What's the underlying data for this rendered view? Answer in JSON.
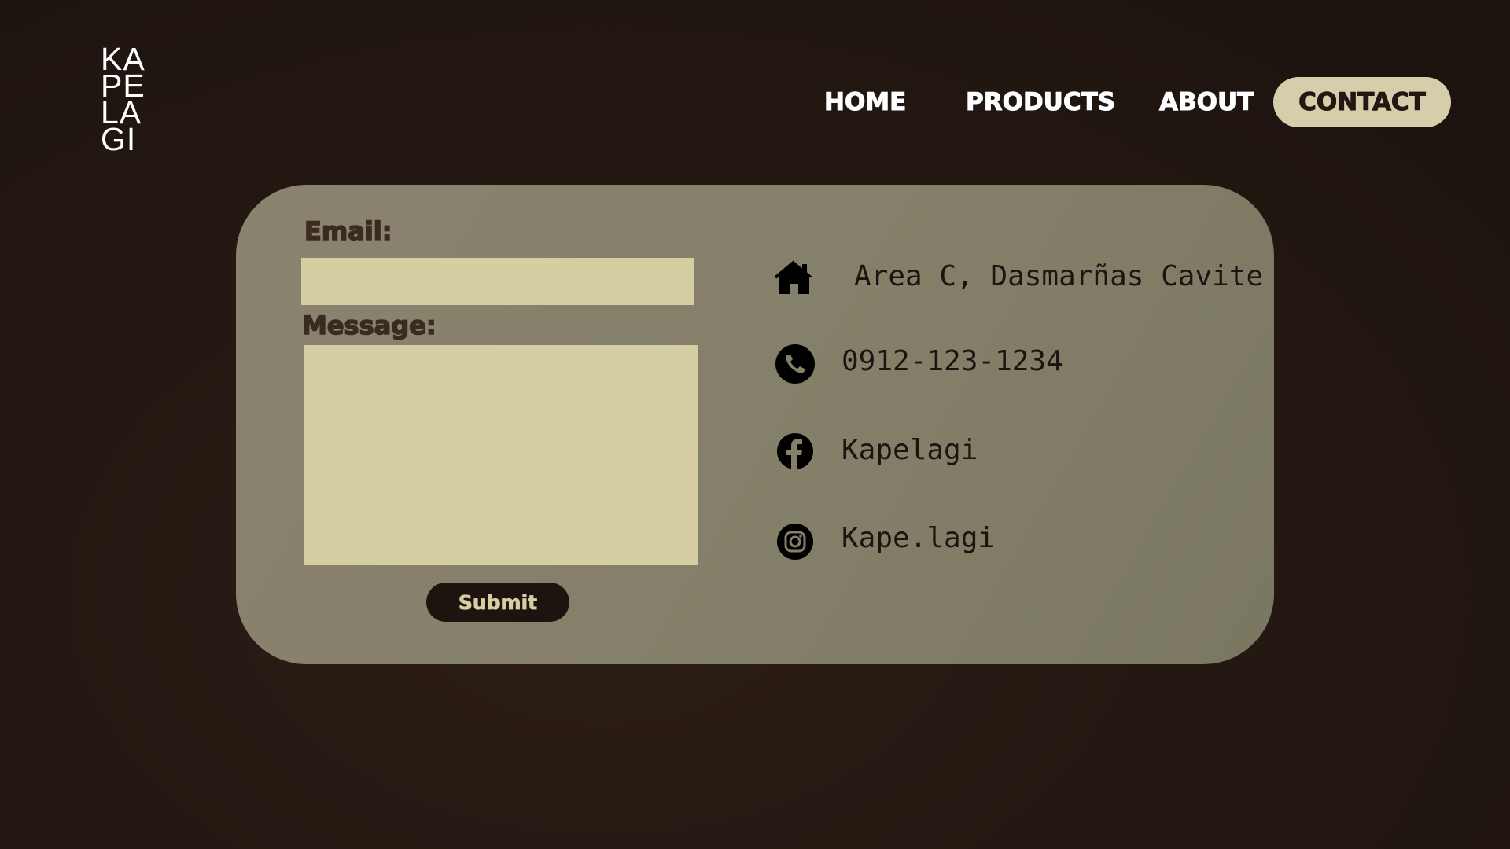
{
  "brand": {
    "logo_rows": [
      "KA",
      "PE",
      "LA",
      "GI"
    ]
  },
  "nav": {
    "items": [
      {
        "label": "HOME"
      },
      {
        "label": "PRODUCTS"
      },
      {
        "label": "ABOUT"
      },
      {
        "label": "CONTACT",
        "active": true
      }
    ],
    "active_color": "#d5ceab"
  },
  "form": {
    "email_label": "Email:",
    "email_value": "",
    "message_label": "Message:",
    "message_value": "",
    "submit_label": "Submit"
  },
  "contact_info": {
    "address": {
      "icon": "home-icon",
      "text": "Area C, Dasmarñas Cavite"
    },
    "phone": {
      "icon": "phone-icon",
      "text": "0912-123-1234"
    },
    "facebook": {
      "icon": "facebook-icon",
      "text": "Kapelagi"
    },
    "instagram": {
      "icon": "instagram-icon",
      "text": "Kape.lagi"
    }
  },
  "colors": {
    "background": "#241812",
    "card": "#858069",
    "input": "#d5cea3",
    "label": "#3a2a22",
    "button": "#1e140f"
  }
}
